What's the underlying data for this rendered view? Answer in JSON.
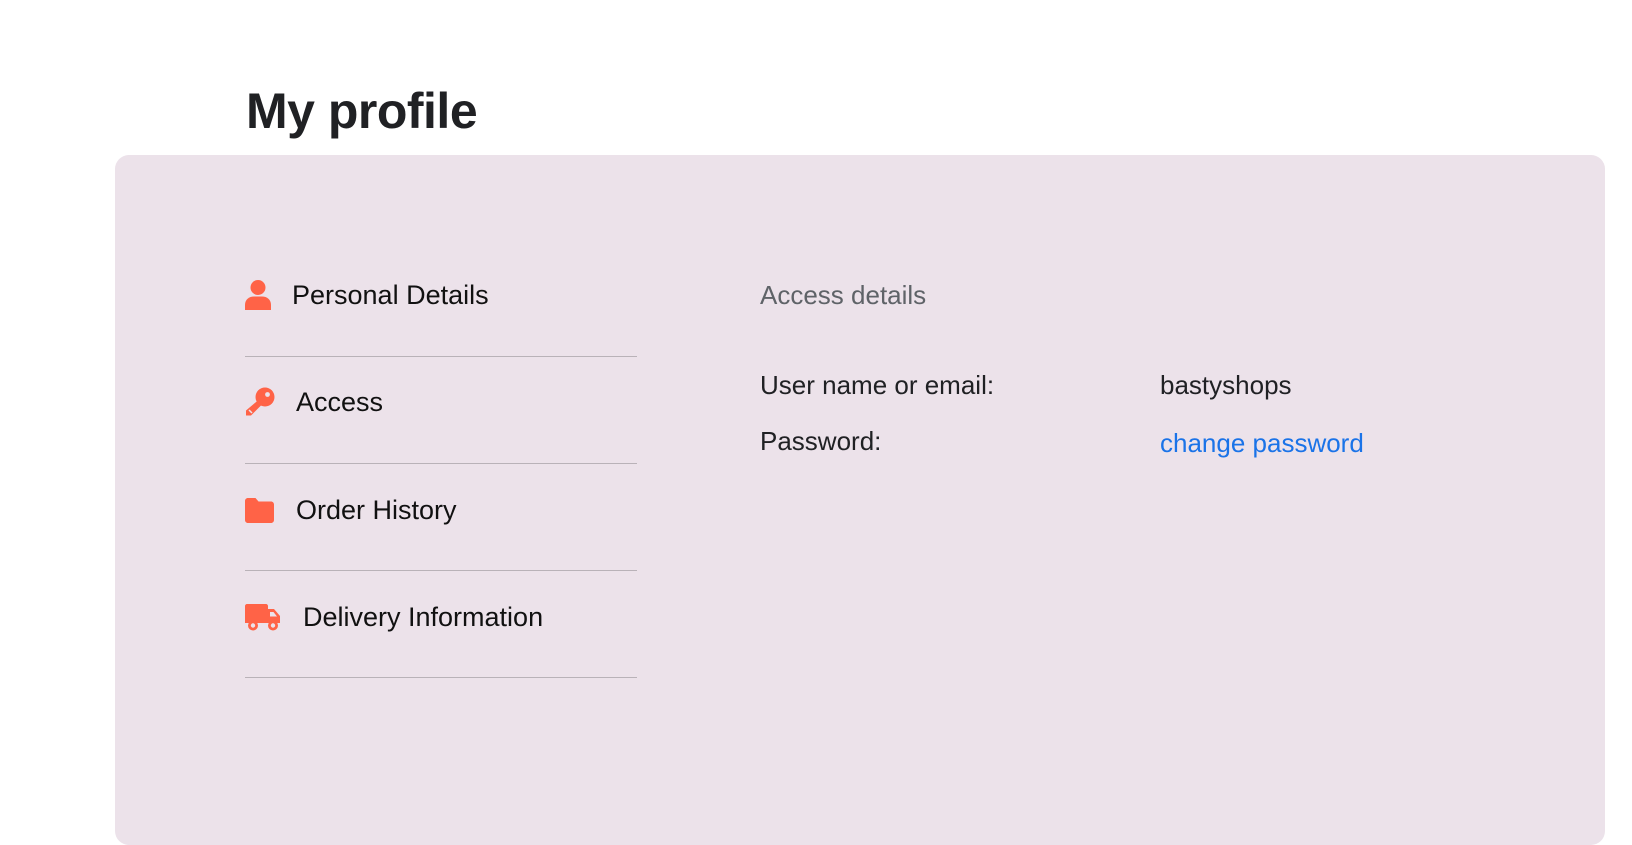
{
  "page": {
    "title": "My profile"
  },
  "sidebar": {
    "items": [
      {
        "label": "Personal Details",
        "icon": "person-icon"
      },
      {
        "label": "Access",
        "icon": "key-icon"
      },
      {
        "label": "Order History",
        "icon": "folder-icon"
      },
      {
        "label": "Delivery Information",
        "icon": "truck-icon"
      }
    ]
  },
  "access": {
    "section_title": "Access details",
    "username_label": "User name or email:",
    "username_value": "bastyshops",
    "password_label": "Password:",
    "change_password_link": "change password"
  },
  "colors": {
    "accent": "#ff6347",
    "panel_background": "#ece2ea",
    "link": "#1a73e8"
  }
}
